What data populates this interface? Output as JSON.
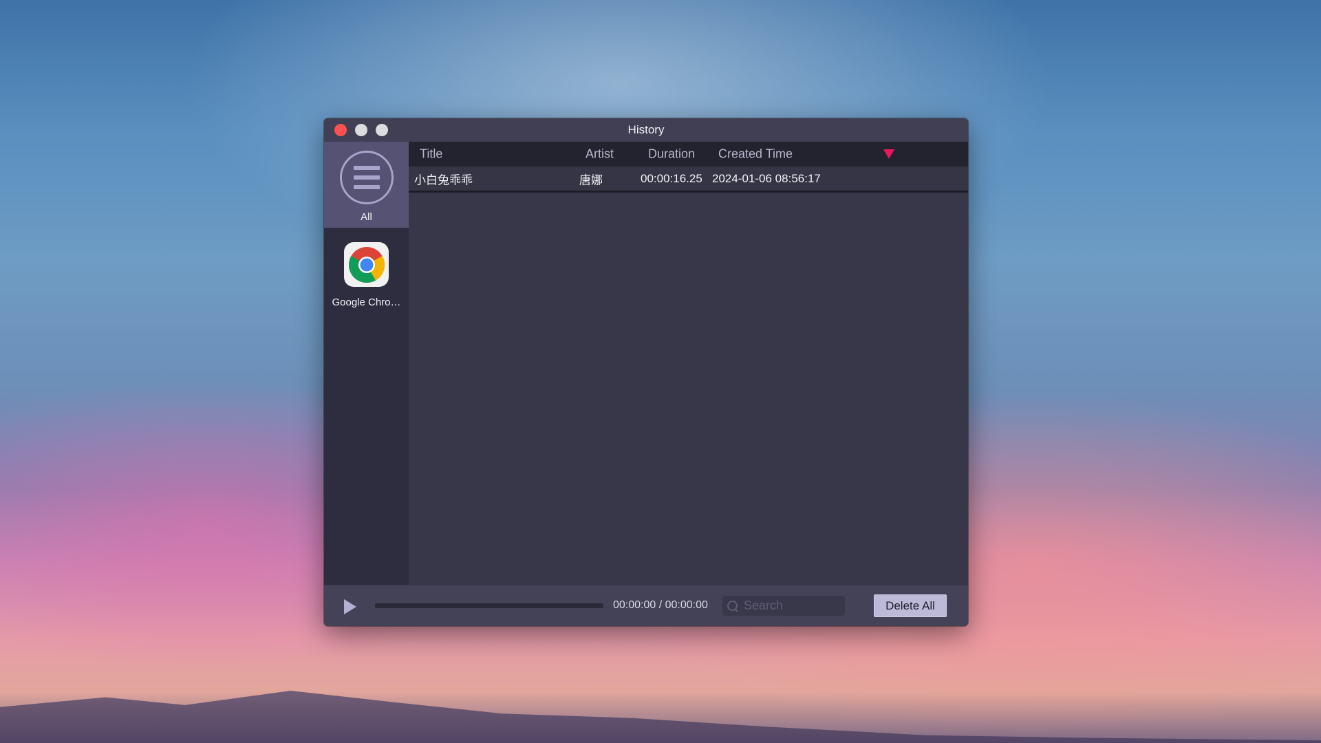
{
  "window": {
    "title": "History"
  },
  "sidebar": {
    "items": [
      {
        "label": "All",
        "icon": "list-icon",
        "selected": true
      },
      {
        "label": "Google Chro…",
        "icon": "google-chrome-icon",
        "selected": false
      }
    ]
  },
  "table": {
    "columns": [
      "Title",
      "Artist",
      "Duration",
      "Created Time"
    ],
    "sort": {
      "column": "Created Time",
      "direction": "descending",
      "color": "#e8195a"
    },
    "rows": [
      {
        "title": "小白兔乖乖",
        "artist": "唐娜",
        "duration": "00:00:16.25",
        "created": "2024-01-06 08:56:17"
      }
    ]
  },
  "player": {
    "progress": 0,
    "time": "00:00:00 / 00:00:00"
  },
  "search": {
    "placeholder": "Search",
    "value": ""
  },
  "toolbar": {
    "delete_all_label": "Delete All"
  }
}
